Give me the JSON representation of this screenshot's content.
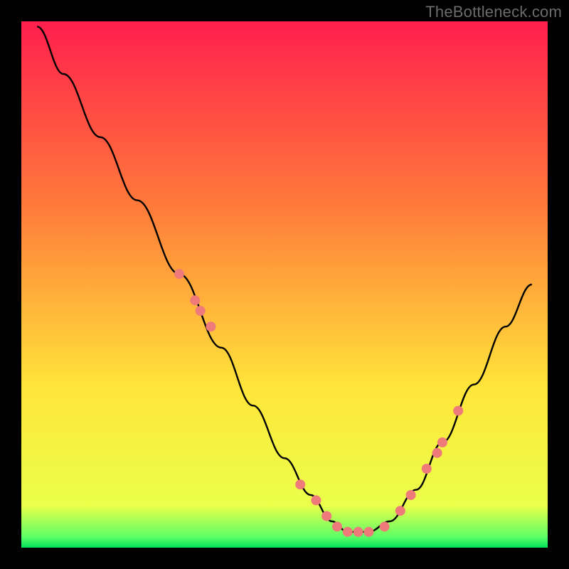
{
  "watermark": "TheBottleneck.com",
  "chart_data": {
    "type": "line",
    "title": "",
    "xlabel": "",
    "ylabel": "",
    "xlim": [
      0,
      100
    ],
    "ylim": [
      0,
      100
    ],
    "grid": false,
    "legend": false,
    "annotations": [],
    "gradient_bands": {
      "description": "vertical gradient background red→orange→yellow→green with green concentrated at bottom",
      "stops": [
        {
          "pos": 0,
          "color": "#ff1f4d"
        },
        {
          "pos": 35,
          "color": "#ff7a3a"
        },
        {
          "pos": 70,
          "color": "#ffe63a"
        },
        {
          "pos": 92,
          "color": "#eaff4a"
        },
        {
          "pos": 98,
          "color": "#5bff66"
        },
        {
          "pos": 100,
          "color": "#00e05a"
        }
      ]
    },
    "series": [
      {
        "name": "bottleneck-curve",
        "type": "line",
        "x": [
          3,
          8,
          15,
          22,
          30,
          38,
          44,
          50,
          55,
          59,
          62,
          66,
          70,
          75,
          80,
          86,
          92,
          97
        ],
        "y": [
          99,
          90,
          78,
          66,
          52,
          38,
          27,
          17,
          10,
          5,
          3,
          3,
          5,
          11,
          20,
          31,
          42,
          50
        ]
      },
      {
        "name": "bottleneck-markers",
        "type": "scatter",
        "x": [
          30,
          33,
          34,
          36,
          53,
          56,
          58,
          60,
          62,
          64,
          66,
          69,
          72,
          74,
          77,
          79,
          80,
          83
        ],
        "y": [
          52,
          47,
          45,
          42,
          12,
          9,
          6,
          4,
          3,
          3,
          3,
          4,
          7,
          10,
          15,
          18,
          20,
          26
        ],
        "marker_color": "#ef7a7a",
        "marker_radius": 7
      }
    ]
  }
}
